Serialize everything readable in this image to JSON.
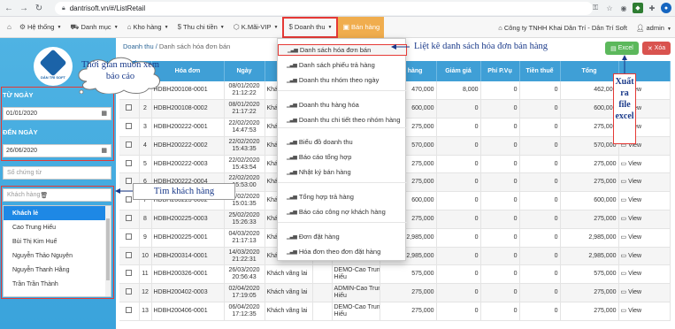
{
  "browser": {
    "url": "dantrisoft.vn/#/ListRetail"
  },
  "menu": {
    "items": [
      {
        "label": "Hệ thống",
        "icon": "gear-icon"
      },
      {
        "label": "Danh mục",
        "icon": "cart-icon"
      },
      {
        "label": "Kho hàng",
        "icon": "home-icon"
      },
      {
        "label": "Thu chi tiền",
        "icon": "dollar-icon"
      },
      {
        "label": "K.Mãi-VIP",
        "icon": "tag-icon"
      },
      {
        "label": "Doanh thu",
        "icon": "dollar-icon"
      },
      {
        "label": "Bán hàng",
        "icon": "store-icon"
      }
    ],
    "company": "Công ty TNHH Khai Dân Trí - Dân Trí Soft",
    "user": "admin"
  },
  "sidebar": {
    "logo_text": "DÂN TRÍ SOFT",
    "from_label": "TỪ NGÀY",
    "from_value": "01/01/2020",
    "to_label": "ĐẾN NGÀY",
    "to_value": "26/06/2020",
    "voucher_placeholder": "Số chứng từ",
    "customer_placeholder": "Khách hàng",
    "customers": [
      "Khách lẻ",
      "Cao Trung Hiếu",
      "Bùi Thị Kim Huế",
      "Nguyễn Thảo Nguyên",
      "Nguyễn Thanh Hằng",
      "Trần Trần Thành"
    ]
  },
  "breadcrumb": {
    "parent": "Doanh thu",
    "current": "Danh sách hóa đơn bán"
  },
  "buttons": {
    "excel": "Excel",
    "close": "Xóa"
  },
  "table": {
    "headers": [
      "",
      "",
      "Hóa đơn",
      "Ngày",
      "Khách",
      "",
      "",
      "Tiền hàng",
      "Giảm giá",
      "Phí P.Vụ",
      "Tiền thuế",
      "Tổng",
      ""
    ],
    "view_label": "View",
    "rows": [
      {
        "stt": "1",
        "code": "HDBH200108-0001",
        "date": "08/01/2020",
        "time": "21:12:22",
        "customer": "Khách vãng lai",
        "note": "",
        "note2": "",
        "amount": "470,000",
        "discount": "8,000",
        "fee": "0",
        "tax": "0",
        "total": "462,000"
      },
      {
        "stt": "2",
        "code": "HDBH200108-0002",
        "date": "08/01/2020",
        "time": "21:17:22",
        "customer": "Khách vãng lai",
        "note": "",
        "note2": "",
        "amount": "600,000",
        "discount": "0",
        "fee": "0",
        "tax": "0",
        "total": "600,000"
      },
      {
        "stt": "3",
        "code": "HDBH200222-0001",
        "date": "22/02/2020",
        "time": "14:47:53",
        "customer": "Khách vãng lai",
        "note": "",
        "note2": "",
        "amount": "275,000",
        "discount": "0",
        "fee": "0",
        "tax": "0",
        "total": "275,000"
      },
      {
        "stt": "4",
        "code": "HDBH200222-0002",
        "date": "22/02/2020",
        "time": "15:43:35",
        "customer": "Khách vãng lai",
        "note": "",
        "note2": "",
        "amount": "570,000",
        "discount": "0",
        "fee": "0",
        "tax": "0",
        "total": "570,000"
      },
      {
        "stt": "5",
        "code": "HDBH200222-0003",
        "date": "22/02/2020",
        "time": "15:43:54",
        "customer": "Khách vãng lai",
        "note": "",
        "note2": "",
        "amount": "275,000",
        "discount": "0",
        "fee": "0",
        "tax": "0",
        "total": "275,000"
      },
      {
        "stt": "6",
        "code": "HDBH200222-0004",
        "date": "22/02/2020",
        "time": "15:53:00",
        "customer": "Khách vãng lai",
        "note": "",
        "note2": "",
        "amount": "275,000",
        "discount": "0",
        "fee": "0",
        "tax": "0",
        "total": "275,000"
      },
      {
        "stt": "7",
        "code": "HDBH200223-0002",
        "date": "23/02/2020",
        "time": "15:01:35",
        "customer": "Khách vãng lai",
        "note": "",
        "note2": "",
        "amount": "600,000",
        "discount": "0",
        "fee": "0",
        "tax": "0",
        "total": "600,000"
      },
      {
        "stt": "8",
        "code": "HDBH200225-0003",
        "date": "25/02/2020",
        "time": "15:26:33",
        "customer": "Khách vãng lai",
        "note": "",
        "note2": "",
        "amount": "275,000",
        "discount": "0",
        "fee": "0",
        "tax": "0",
        "total": "275,000"
      },
      {
        "stt": "9",
        "code": "HDBH200225-0001",
        "date": "04/03/2020",
        "time": "21:17:13",
        "customer": "Khách vãng lai",
        "note": "",
        "note2": "",
        "amount": "2,985,000",
        "discount": "0",
        "fee": "0",
        "tax": "0",
        "total": "2,985,000"
      },
      {
        "stt": "10",
        "code": "HDBH200314-0001",
        "date": "14/03/2020",
        "time": "21:22:31",
        "customer": "Khách vãng lai",
        "note": "Cao Trung",
        "note2": "Hiếu",
        "amount": "2,985,000",
        "discount": "0",
        "fee": "0",
        "tax": "0",
        "total": "2,985,000"
      },
      {
        "stt": "11",
        "code": "HDBH200326-0001",
        "date": "26/03/2020",
        "time": "20:56:43",
        "customer": "Khách vãng lai",
        "note": "DEMO-Cao Trung",
        "note2": "Hiếu",
        "amount": "575,000",
        "discount": "0",
        "fee": "0",
        "tax": "0",
        "total": "575,000"
      },
      {
        "stt": "12",
        "code": "HDBH200402-0003",
        "date": "02/04/2020",
        "time": "17:19:05",
        "customer": "Khách vãng lai",
        "note": "ADMIN-Cao Trung",
        "note2": "Hiếu",
        "amount": "275,000",
        "discount": "0",
        "fee": "0",
        "tax": "0",
        "total": "275,000"
      },
      {
        "stt": "13",
        "code": "HDBH200406-0001",
        "date": "06/04/2020",
        "time": "17:12:35",
        "customer": "Khách vãng lai",
        "note": "DEMO-Cao Trung",
        "note2": "Hiếu",
        "amount": "275,000",
        "discount": "0",
        "fee": "0",
        "tax": "0",
        "total": "275,000"
      }
    ]
  },
  "dropdown": {
    "items": [
      "Danh sách hóa đơn bán",
      "Danh sách phiếu trả hàng",
      "Doanh thu nhóm theo ngày",
      "Doanh thu hàng hóa",
      "Doanh thu chi tiết theo nhóm hàng",
      "Biểu đồ doanh thu",
      "Báo cáo tổng hợp",
      "Nhật ký bán hàng",
      "Tổng hợp trả hàng",
      "Báo cáo công nợ khách hàng",
      "Đơn đặt hàng",
      "Hóa đơn theo đơn đặt hàng"
    ]
  },
  "annotations": {
    "list_title": "Liệt kê danh sách hóa đơn bán hàng",
    "time_range_line1": "Thời gian muốn xem",
    "time_range_line2": "báo cáo",
    "find_customer": "Tìm khách hàng",
    "export_line1": "Xuất",
    "export_line2": "ra",
    "export_line3": "file",
    "export_line4": "excel"
  },
  "colors": {
    "accent": "#f0ad4e",
    "sidebar": "#3aa3dc",
    "header": "#3f9fd6",
    "excel": "#5cb85c",
    "danger": "#d9534f",
    "highlight": "#e53935"
  }
}
